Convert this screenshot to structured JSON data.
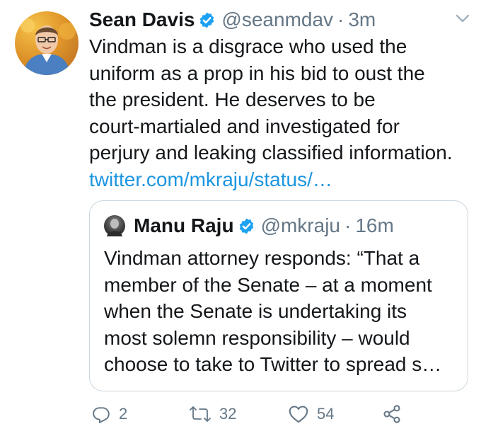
{
  "tweet": {
    "author_name": "Sean Davis",
    "handle": "@seanmdav",
    "separator": "·",
    "time": "3m",
    "text": "Vindman is a disgrace who used the\nuniform as a prop in his bid to oust the\nthe president. He deserves to be\ncourt-martialed and investigated for\nperjury and leaking classified information.",
    "link": "twitter.com/mkraju/status/…",
    "icons": {
      "verified": "verified-badge-icon",
      "menu": "chevron-down-icon"
    },
    "colors": {
      "link": "#1b95e0",
      "verified": "#1da1f2",
      "muted": "#657786"
    }
  },
  "quote": {
    "author_name": "Manu Raju",
    "handle": "@mkraju",
    "separator": "·",
    "time": "16m",
    "text": "Vindman attorney responds: “That a\nmember of the Senate – at a moment\nwhen the Senate is undertaking its\nmost solemn responsibility – would\nchoose to take to Twitter to spread s…"
  },
  "actions": {
    "reply_count": "2",
    "retweet_count": "32",
    "like_count": "54",
    "icons": [
      "reply-icon",
      "retweet-icon",
      "like-icon",
      "share-icon"
    ]
  }
}
